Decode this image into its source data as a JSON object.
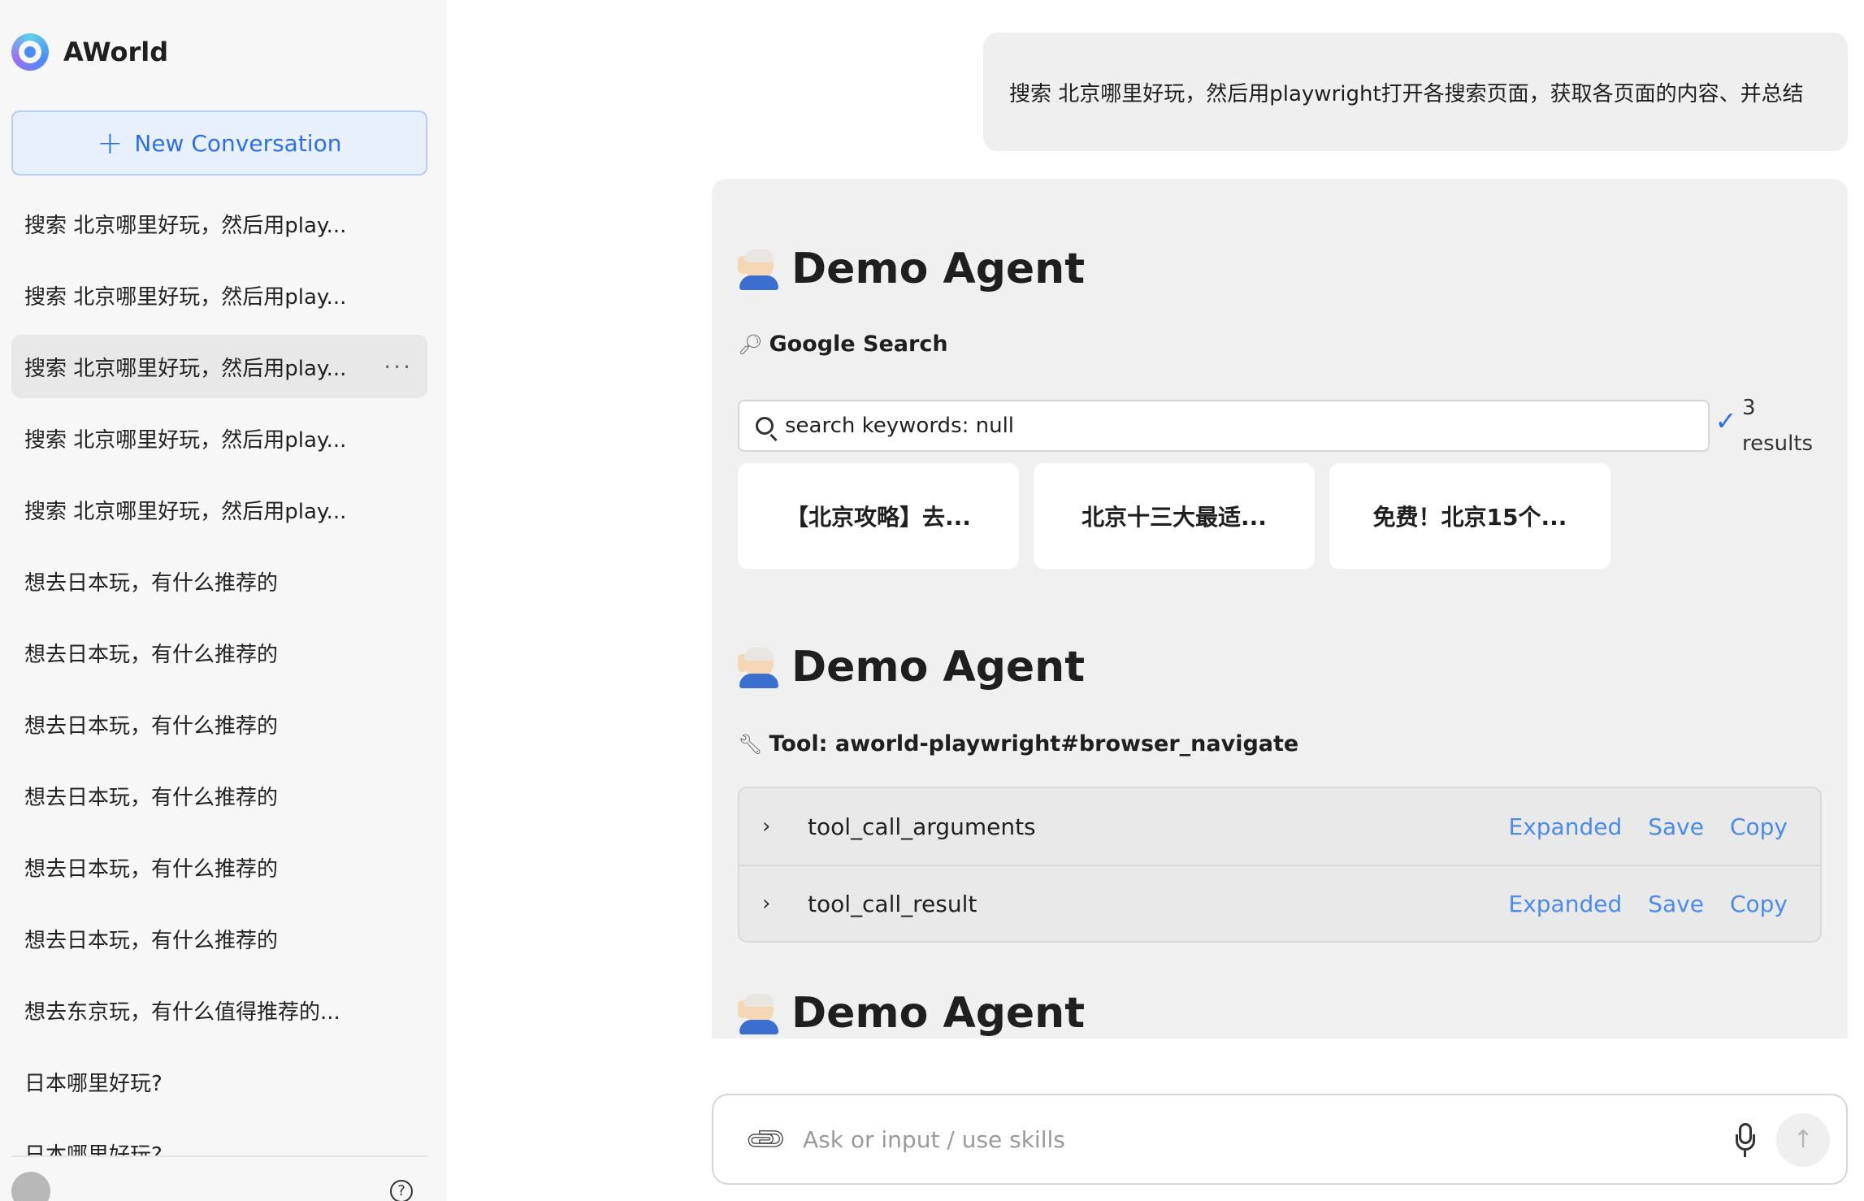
{
  "app": {
    "name": "AWorld"
  },
  "sidebar": {
    "new_conversation_label": "New Conversation",
    "conversations": [
      "搜索 北京哪里好玩，然后用play...",
      "搜索 北京哪里好玩，然后用play...",
      "搜索 北京哪里好玩，然后用play...",
      "搜索 北京哪里好玩，然后用play...",
      "搜索 北京哪里好玩，然后用play...",
      "想去日本玩，有什么推荐的",
      "想去日本玩，有什么推荐的",
      "想去日本玩，有什么推荐的",
      "想去日本玩，有什么推荐的",
      "想去日本玩，有什么推荐的",
      "想去日本玩，有什么推荐的",
      "想去东京玩，有什么值得推荐的...",
      "日本哪里好玩?",
      "日本哪里好玩?"
    ],
    "active_index": 2,
    "more_label": "···",
    "help_label": "?"
  },
  "chat": {
    "user_message": "搜索 北京哪里好玩，然后用playwright打开各搜索页面，获取各页面的内容、并总结",
    "agent_name": "Demo Agent",
    "search_tool_label": "Google Search",
    "search_keywords": "search keywords: null",
    "results_count_number": "3",
    "results_count_word": "results",
    "result_cards": [
      "【北京攻略】去...",
      "北京十三大最适...",
      "免费！北京15个..."
    ],
    "tool_label": "Tool: aworld-playwright#browser_navigate",
    "tool_rows": [
      {
        "label": "tool_call_arguments",
        "expanded": "Expanded",
        "save": "Save",
        "copy": "Copy"
      },
      {
        "label": "tool_call_result",
        "expanded": "Expanded",
        "save": "Save",
        "copy": "Copy"
      }
    ]
  },
  "input": {
    "placeholder": "Ask or input / use skills"
  },
  "icons": {
    "search_tool": "magnifier-icon",
    "tool": "wrench-icon",
    "attach": "paperclip-icon",
    "mic": "microphone-icon",
    "send": "arrow-up-icon"
  },
  "colors": {
    "accent": "#2f6fe4",
    "link": "#4a8ce8",
    "panel": "#f0f0f0"
  }
}
